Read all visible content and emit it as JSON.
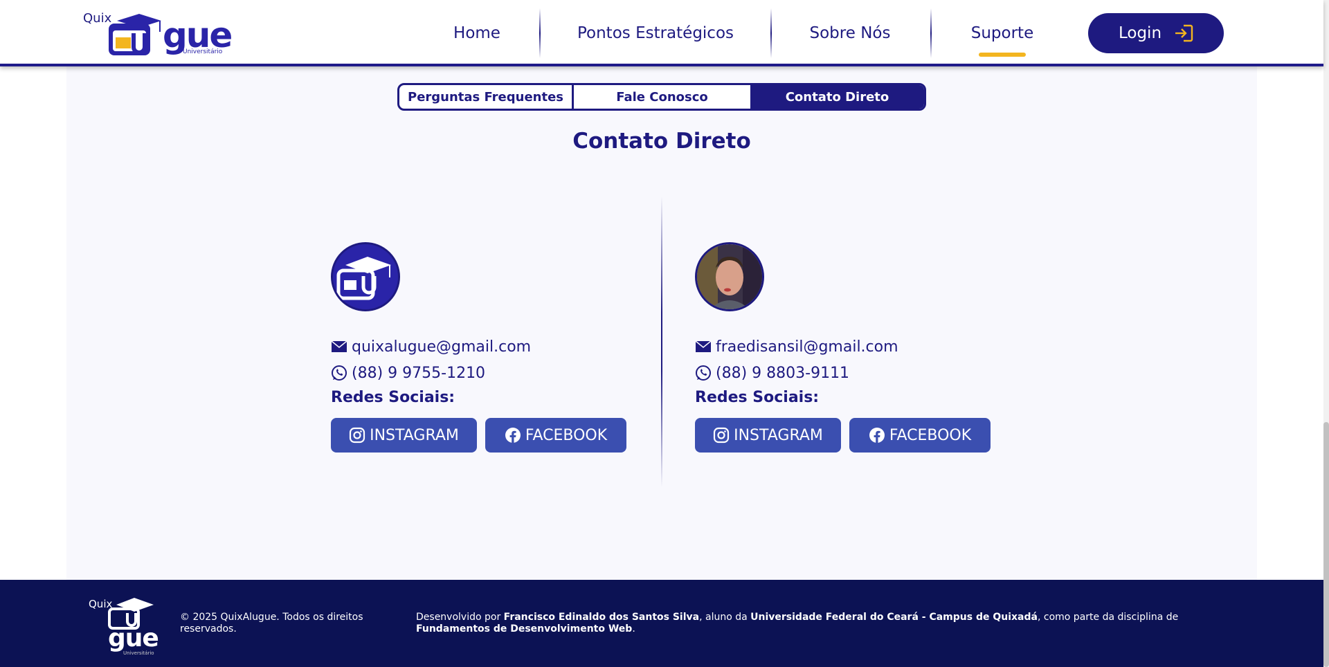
{
  "header": {
    "logo": {
      "quix": "Quix",
      "gue": "gue",
      "universitario": "Universitário"
    },
    "nav": [
      "Home",
      "Pontos Estratégicos",
      "Sobre Nós",
      "Suporte"
    ],
    "active_nav": "Suporte",
    "login_label": "Login"
  },
  "tabs": [
    "Perguntas Frequentes",
    "Fale Conosco",
    "Contato Direto"
  ],
  "active_tab": "Contato Direto",
  "section_title": "Contato Direto",
  "contacts": [
    {
      "email": "quixalugue@gmail.com",
      "phone": "(88) 9 9755-1210",
      "social_title": "Redes Sociais:",
      "instagram_label": "INSTAGRAM",
      "facebook_label": "FACEBOOK",
      "avatar_icon": "quixalugue-logo-icon"
    },
    {
      "email": "fraedisansil@gmail.com",
      "phone": "(88) 9 8803-9111",
      "social_title": "Redes Sociais:",
      "instagram_label": "INSTAGRAM",
      "facebook_label": "FACEBOOK",
      "avatar_icon": "user-photo"
    }
  ],
  "footer": {
    "logo": {
      "quix": "Quix",
      "gue": "gue",
      "universitario": "Universitário"
    },
    "copyright": "© 2025 QuixAlugue. Todos os direitos reservados.",
    "credits_prefix": "Desenvolvido por ",
    "developer": "Francisco Edinaldo dos Santos Silva",
    "credits_mid1": ", aluno da ",
    "university": "Universidade Federal do Ceará - Campus de Quixadá",
    "credits_mid2": ", como parte da disciplina de ",
    "course": "Fundamentos de Desenvolvimento Web",
    "credits_end": "."
  },
  "colors": {
    "primary": "#1e1a80",
    "accent": "#f3b51f",
    "button": "#3b4fb0",
    "footer": "#0c1254",
    "panel": "#f8f8fd"
  }
}
